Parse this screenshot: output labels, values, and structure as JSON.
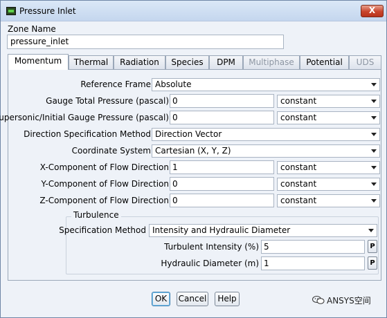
{
  "window": {
    "title": "Pressure Inlet",
    "close_label": "X"
  },
  "zone": {
    "label": "Zone Name",
    "value": "pressure_inlet"
  },
  "tabs": [
    {
      "label": "Momentum",
      "state": "active"
    },
    {
      "label": "Thermal",
      "state": "normal"
    },
    {
      "label": "Radiation",
      "state": "normal"
    },
    {
      "label": "Species",
      "state": "normal"
    },
    {
      "label": "DPM",
      "state": "normal"
    },
    {
      "label": "Multiphase",
      "state": "disabled"
    },
    {
      "label": "Potential",
      "state": "normal"
    },
    {
      "label": "UDS",
      "state": "disabled"
    }
  ],
  "momentum": {
    "reference_frame": {
      "label": "Reference Frame",
      "value": "Absolute"
    },
    "gauge_total_pressure": {
      "label": "Gauge Total Pressure (pascal)",
      "value": "0",
      "method": "constant"
    },
    "supersonic_pressure": {
      "label": "Supersonic/Initial Gauge Pressure (pascal)",
      "value": "0",
      "method": "constant"
    },
    "direction_method": {
      "label": "Direction Specification Method",
      "value": "Direction Vector"
    },
    "coordinate_system": {
      "label": "Coordinate System",
      "value": "Cartesian (X, Y, Z)"
    },
    "x_component": {
      "label": "X-Component of Flow Direction",
      "value": "1",
      "method": "constant"
    },
    "y_component": {
      "label": "Y-Component of Flow Direction",
      "value": "0",
      "method": "constant"
    },
    "z_component": {
      "label": "Z-Component of Flow Direction",
      "value": "0",
      "method": "constant"
    },
    "turbulence": {
      "title": "Turbulence",
      "spec_method": {
        "label": "Specification Method",
        "value": "Intensity and Hydraulic Diameter"
      },
      "intensity": {
        "label": "Turbulent Intensity (%)",
        "value": "5",
        "p_label": "P"
      },
      "hydraulic_diameter": {
        "label": "Hydraulic Diameter (m)",
        "value": "1",
        "p_label": "P"
      }
    }
  },
  "buttons": {
    "ok": "OK",
    "cancel": "Cancel",
    "help": "Help"
  },
  "watermark": {
    "text": "ANSYS空间"
  }
}
